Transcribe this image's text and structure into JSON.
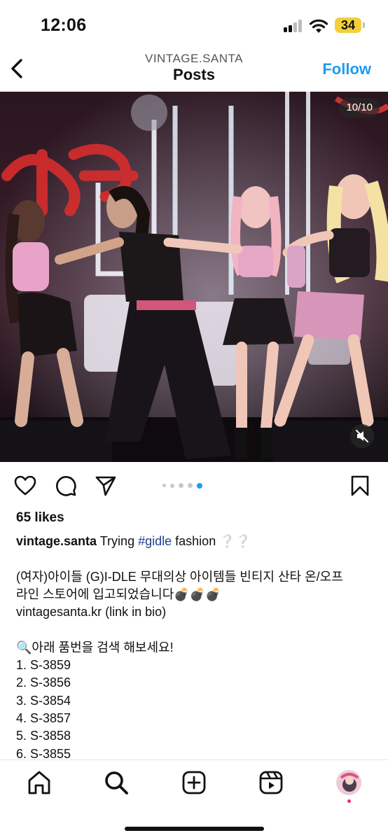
{
  "status_bar": {
    "time": "12:06",
    "battery": "34",
    "battery_color": "#f3cf3a"
  },
  "header": {
    "username": "VINTAGE.SANTA",
    "title": "Posts",
    "follow_label": "Follow",
    "back_icon": "chevron-left-icon",
    "accent": "#1e9bf0"
  },
  "post": {
    "media": {
      "counter": "10/10",
      "mute_icon": "speaker-muted-icon"
    },
    "actions": {
      "like_icon": "heart-icon",
      "comment_icon": "comment-icon",
      "share_icon": "paper-plane-icon",
      "save_icon": "bookmark-icon",
      "carousel_total_dots": 5,
      "carousel_active_index": 4
    },
    "likes": "65 likes",
    "caption": {
      "username": "vintage.santa",
      "text_before_tag": "Trying",
      "hashtag": "#gidle",
      "text_after_tag": "fashion ❔❔",
      "lines": [
        "(여자)아이들 (G)I-DLE 무대의상 아이템들 빈티지 산타 온/오프",
        "라인 스토어에 입고되었습니다💣💣💣",
        "vintagesanta.kr (link in bio)",
        "",
        "🔍아래 품번을 검색 해보세요!",
        "1. S-3859",
        "2. S-3856",
        "3. S-3854",
        "4. S-3857",
        "5. S-3858",
        "6. S-3855"
      ]
    }
  },
  "bottom_nav": {
    "items": [
      {
        "name": "home",
        "icon": "home-icon"
      },
      {
        "name": "search",
        "icon": "search-icon"
      },
      {
        "name": "create",
        "icon": "plus-square-icon"
      },
      {
        "name": "reels",
        "icon": "reels-icon"
      },
      {
        "name": "profile",
        "icon": "avatar"
      }
    ]
  }
}
